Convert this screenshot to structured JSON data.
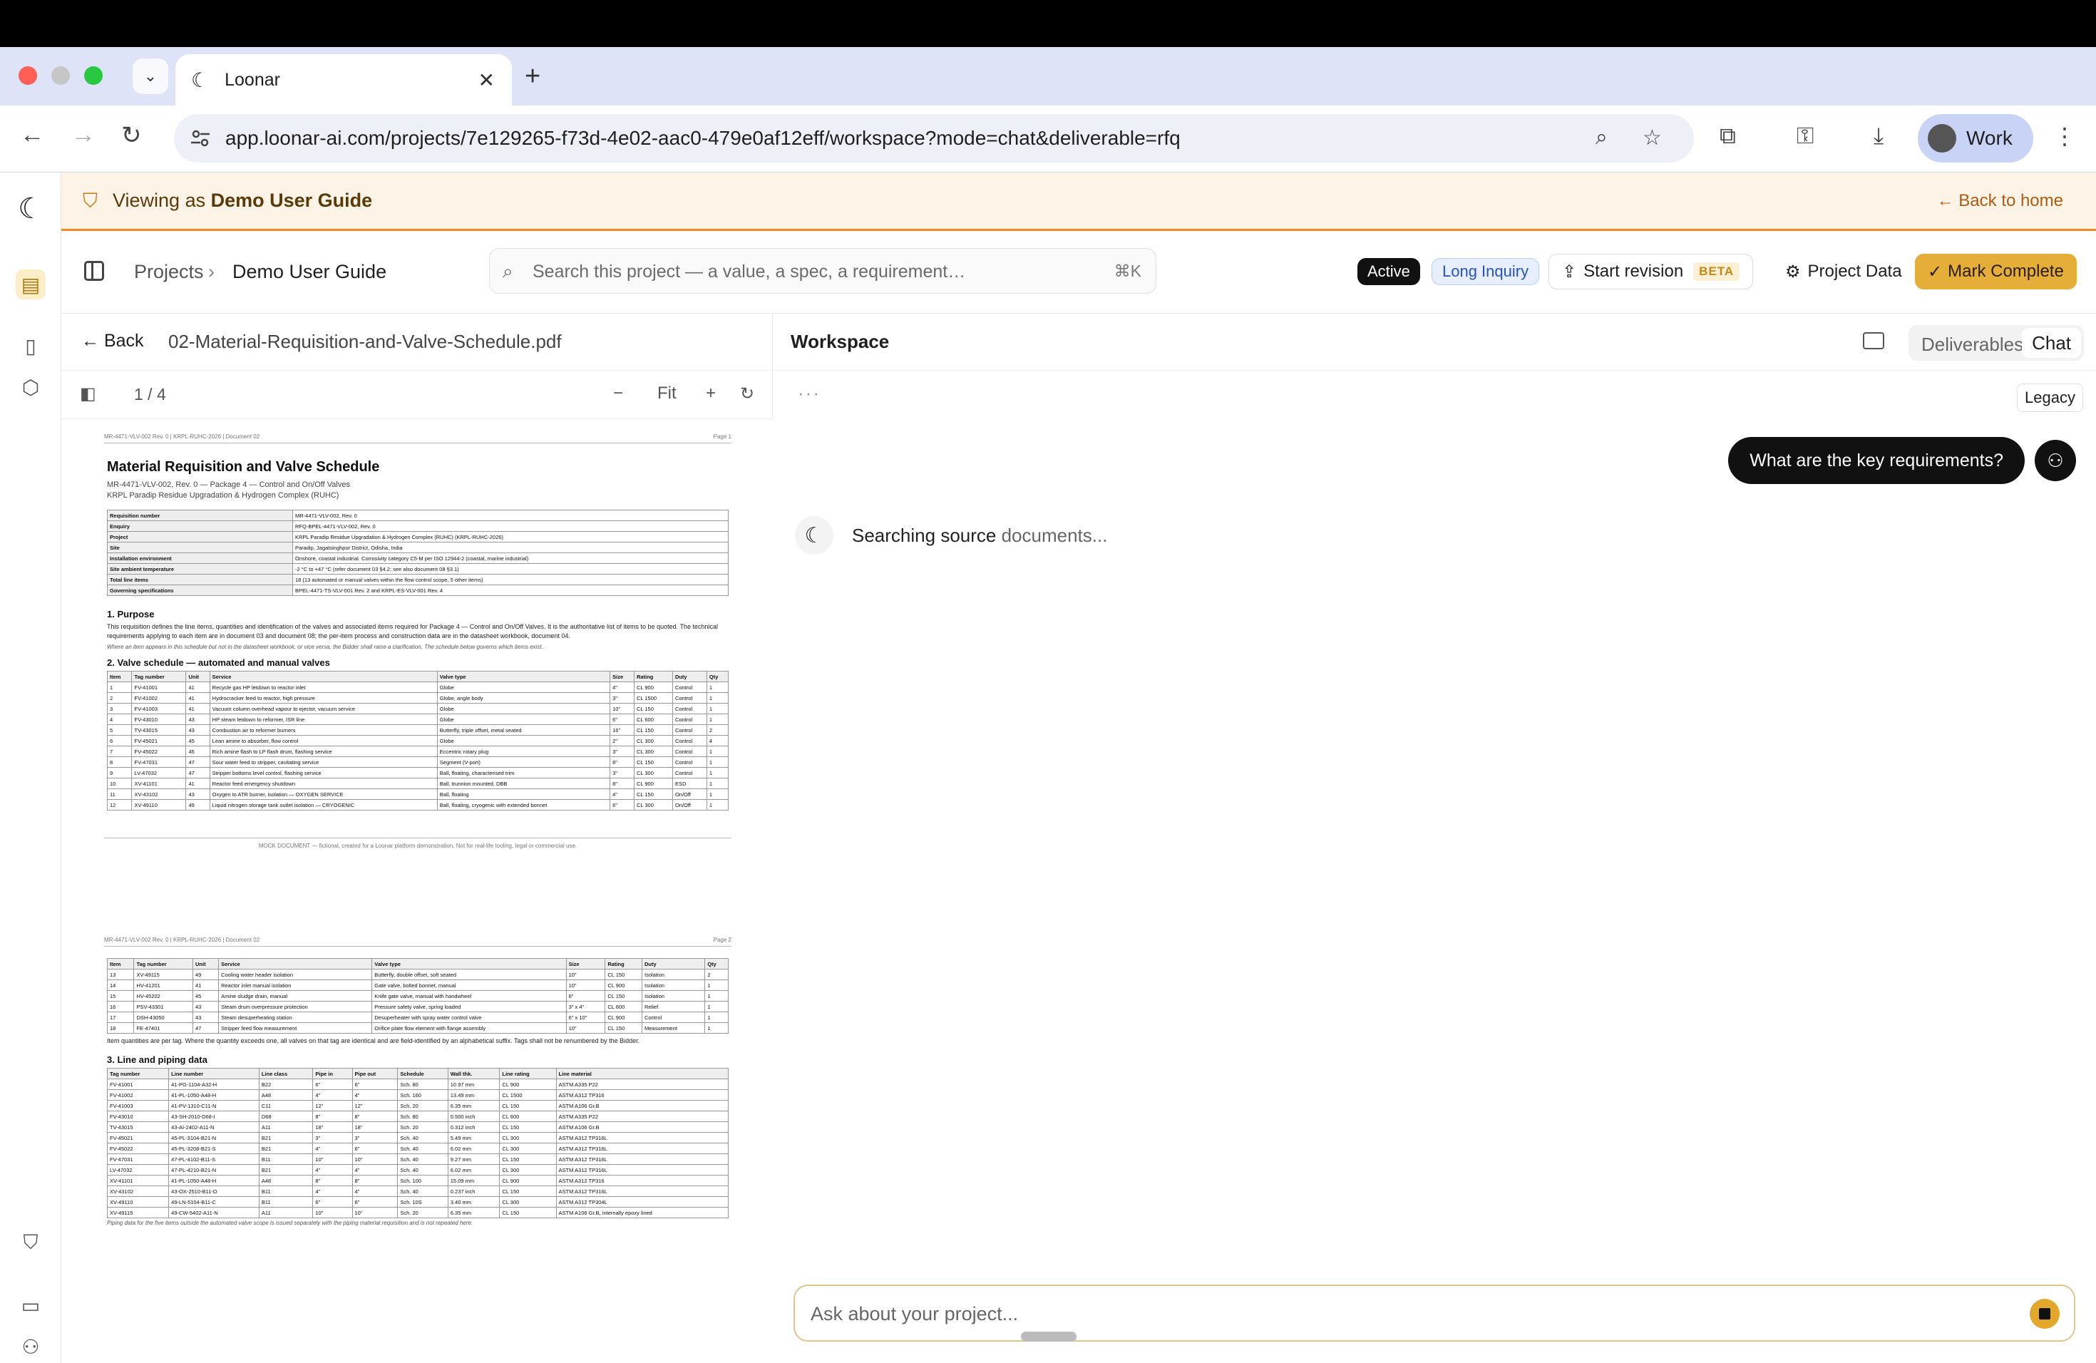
{
  "browser": {
    "tab_title": "Loonar",
    "url": "app.loonar-ai.com/projects/7e129265-f73d-4e02-aac0-479e0af12eff/workspace?mode=chat&deliverable=rfq",
    "profile_label": "Work"
  },
  "banner": {
    "prefix": "Viewing as",
    "user": "Demo User Guide",
    "back_label": "Back to home"
  },
  "header": {
    "crumb_root": "Projects",
    "crumb_current": "Demo User Guide",
    "search_placeholder": "Search this project — a value, a spec, a requirement…",
    "search_shortcut": "⌘K",
    "status_active": "Active",
    "status_inquiry": "Long Inquiry",
    "start_revision": "Start revision",
    "beta": "BETA",
    "project_data": "Project Data",
    "mark_complete": "Mark Complete"
  },
  "doc": {
    "back": "Back",
    "filename": "02-Material-Requisition-and-Valve-Schedule.pdf",
    "page_indicator": "1 / 4",
    "zoom_label": "Fit",
    "page1": {
      "hdr_left": "MR-4471-VLV-002 Rev. 0 | KRPL-RUHC-2026 | Document 02",
      "hdr_right": "Page 1",
      "title": "Material Requisition and Valve Schedule",
      "sub1": "MR-4471-VLV-002, Rev. 0 — Package 4 — Control and On/Off Valves",
      "sub2": "KRPL Paradip Residue Upgradation & Hydrogen Complex (RUHC)",
      "kv": [
        [
          "Requisition number",
          "MR-4471-VLV-002, Rev. 0"
        ],
        [
          "Enquiry",
          "RFQ-BPEL-4471-VLV-002, Rev. 0"
        ],
        [
          "Project",
          "KRPL Paradip Residue Upgradation & Hydrogen Complex (RUHC) (KRPL-RUHC-2026)"
        ],
        [
          "Site",
          "Paradip, Jagatsinghpur District, Odisha, India"
        ],
        [
          "Installation environment",
          "Onshore, coastal industrial. Corrosivity category C5-M per ISO 12944-2 (coastal, marine industrial)"
        ],
        [
          "Site ambient temperature",
          "-2 °C to +47 °C (refer document 03 §4.2; see also document 08 §3.1)"
        ],
        [
          "Total line items",
          "18 (13 automated or manual valves within the flow control scope, 5 other items)"
        ],
        [
          "Governing specifications",
          "BPEL-4471-TS-VLV-001 Rev. 2 and KRPL-ES-VLV-001 Rev. 4"
        ]
      ],
      "s1": "1. Purpose",
      "s1_text": "This requisition defines the line items, quantities and identification of the valves and associated items required for Package 4 — Control and On/Off Valves. It is the authoritative list of items to be quoted. The technical requirements applying to each item are in document 03 and document 08; the per-item process and construction data are in the datasheet workbook, document 04.",
      "s1_note": "Where an item appears in this schedule but not in the datasheet workbook, or vice versa, the Bidder shall raise a clarification. The schedule below governs which items exist.",
      "s2": "2. Valve schedule — automated and manual valves",
      "vs_headers": [
        "Item",
        "Tag number",
        "Unit",
        "Service",
        "Valve type",
        "Size",
        "Rating",
        "Duty",
        "Qty"
      ],
      "vs_rows": [
        [
          "1",
          "FV-41001",
          "41",
          "Recycle gas HP letdown to reactor inlet",
          "Globe",
          "4\"",
          "CL 900",
          "Control",
          "1"
        ],
        [
          "2",
          "FV-41002",
          "41",
          "Hydrocracker feed to reactor, high pressure",
          "Globe, angle body",
          "3\"",
          "CL 1500",
          "Control",
          "1"
        ],
        [
          "3",
          "FV-41003",
          "41",
          "Vacuum column overhead vapour to ejector, vacuum service",
          "Globe",
          "10\"",
          "CL 150",
          "Control",
          "1"
        ],
        [
          "4",
          "FV-43010",
          "43",
          "HP steam letdown to reformer, ISR line",
          "Globe",
          "6\"",
          "CL 600",
          "Control",
          "1"
        ],
        [
          "5",
          "TV-43015",
          "43",
          "Combustion air to reformer burners",
          "Butterfly, triple offset, metal seated",
          "16\"",
          "CL 150",
          "Control",
          "2"
        ],
        [
          "6",
          "FV-45021",
          "45",
          "Lean amine to absorber, flow control",
          "Globe",
          "2\"",
          "CL 300",
          "Control",
          "4"
        ],
        [
          "7",
          "FV-45022",
          "45",
          "Rich amine flash to LP flash drum, flashing service",
          "Eccentric rotary plug",
          "3\"",
          "CL 300",
          "Control",
          "1"
        ],
        [
          "8",
          "FV-47031",
          "47",
          "Sour water feed to stripper, cavitating service",
          "Segment (V-port)",
          "8\"",
          "CL 150",
          "Control",
          "1"
        ],
        [
          "9",
          "LV-47032",
          "47",
          "Stripper bottoms level control, flashing service",
          "Ball, floating, characterised trim",
          "3\"",
          "CL 300",
          "Control",
          "1"
        ],
        [
          "10",
          "XV-41101",
          "41",
          "Reactor feed emergency shutdown",
          "Ball, trunnion mounted, DBB",
          "8\"",
          "CL 900",
          "ESD",
          "1"
        ],
        [
          "11",
          "XV-43102",
          "43",
          "Oxygen to ATR burner, isolation — OXYGEN SERVICE",
          "Ball, floating",
          "4\"",
          "CL 150",
          "On/Off",
          "1"
        ],
        [
          "12",
          "XV-49110",
          "49",
          "Liquid nitrogen storage tank outlet isolation — CRYOGENIC",
          "Ball, floating, cryogenic with extended bonnet",
          "6\"",
          "CL 300",
          "On/Off",
          "1"
        ]
      ],
      "footer": "MOCK DOCUMENT — fictional, created for a Loonar platform demonstration. Not for real-life tooling, legal or commercial use."
    },
    "page2": {
      "hdr_left": "MR-4471-VLV-002 Rev. 0 | KRPL-RUHC-2026 | Document 02",
      "hdr_right": "Page 2",
      "vs_rows": [
        [
          "13",
          "XV-49115",
          "49",
          "Cooling water header isolation",
          "Butterfly, double offset, soft seated",
          "10\"",
          "CL 150",
          "Isolation",
          "2"
        ],
        [
          "14",
          "HV-41201",
          "41",
          "Reactor inlet manual isolation",
          "Gate valve, bolted bonnet, manual",
          "10\"",
          "CL 900",
          "Isolation",
          "1"
        ],
        [
          "15",
          "HV-45202",
          "45",
          "Amine sludge drain, manual",
          "Knife gate valve, manual with handwheel",
          "6\"",
          "CL 150",
          "Isolation",
          "1"
        ],
        [
          "16",
          "PSV-43301",
          "43",
          "Steam drum overpressure protection",
          "Pressure safety valve, spring loaded",
          "3\" x 4\"",
          "CL 600",
          "Relief",
          "1"
        ],
        [
          "17",
          "DSH-43050",
          "43",
          "Steam desuperheating station",
          "Desuperheater with spray water control valve",
          "6\" x 10\"",
          "CL 900",
          "Control",
          "1"
        ],
        [
          "18",
          "FE-47401",
          "47",
          "Stripper feed flow measurement",
          "Orifice plate flow element with flange assembly",
          "10\"",
          "CL 150",
          "Measurement",
          "1"
        ]
      ],
      "qty_note": "Item quantities are per tag. Where the quantity exceeds one, all valves on that tag are identical and are field-identified by an alphabetical suffix. Tags shall not be renumbered by the Bidder.",
      "s3": "3. Line and piping data",
      "lp_headers": [
        "Tag number",
        "Line number",
        "Line class",
        "Pipe in",
        "Pipe out",
        "Schedule",
        "Wall thk.",
        "Line rating",
        "Line material"
      ],
      "lp_rows": [
        [
          "FV-41001",
          "41-PG-1104-A32-H",
          "B22",
          "6\"",
          "6\"",
          "Sch. 80",
          "10.97 mm",
          "CL 900",
          "ASTM A335 P22"
        ],
        [
          "FV-41002",
          "41-PL-1050-A48-H",
          "A48",
          "4\"",
          "4\"",
          "Sch. 160",
          "13.49 mm",
          "CL 1500",
          "ASTM A312 TP316"
        ],
        [
          "FV-41003",
          "41-PV-1310-C11-N",
          "C11",
          "12\"",
          "12\"",
          "Sch. 20",
          "6.35 mm",
          "CL 150",
          "ASTM A106 Gr.B"
        ],
        [
          "FV-43010",
          "43-SH-2010-D68-I",
          "D68",
          "8\"",
          "8\"",
          "Sch. 80",
          "0.500 inch",
          "CL 600",
          "ASTM A335 P22"
        ],
        [
          "TV-43015",
          "43-AI-2402-A11-N",
          "A11",
          "18\"",
          "18\"",
          "Sch. 20",
          "0.312 inch",
          "CL 150",
          "ASTM A106 Gr.B"
        ],
        [
          "FV-45021",
          "45-PL-3104-B21-N",
          "B21",
          "3\"",
          "3\"",
          "Sch. 40",
          "5.49 mm",
          "CL 300",
          "ASTM A312 TP316L"
        ],
        [
          "FV-45022",
          "45-PL-3208-B21-S",
          "B21",
          "4\"",
          "6\"",
          "Sch. 40",
          "6.02 mm",
          "CL 300",
          "ASTM A312 TP316L"
        ],
        [
          "FV-47031",
          "47-PL-4102-B11-S",
          "B11",
          "10\"",
          "10\"",
          "Sch. 40",
          "9.27 mm",
          "CL 150",
          "ASTM A312 TP316L"
        ],
        [
          "LV-47032",
          "47-PL-4210-B21-N",
          "B21",
          "4\"",
          "4\"",
          "Sch. 40",
          "6.02 mm",
          "CL 300",
          "ASTM A312 TP316L"
        ],
        [
          "XV-41101",
          "41-PL-1050-A48-H",
          "A48",
          "8\"",
          "8\"",
          "Sch. 100",
          "15.09 mm",
          "CL 900",
          "ASTM A312 TP316"
        ],
        [
          "XV-43102",
          "43-OX-2510-B11-O",
          "B11",
          "4\"",
          "4\"",
          "Sch. 40",
          "0.237 inch",
          "CL 150",
          "ASTM A312 TP316L"
        ],
        [
          "XV-49110",
          "49-LN-5104-B11-C",
          "B11",
          "6\"",
          "6\"",
          "Sch. 10S",
          "3.40 mm",
          "CL 300",
          "ASTM A312 TP304L"
        ],
        [
          "XV-49115",
          "49-CW-5402-A11-N",
          "A11",
          "10\"",
          "10\"",
          "Sch. 20",
          "6.35 mm",
          "CL 150",
          "ASTM A106 Gr.B, internally epoxy lined"
        ]
      ],
      "lp_note": "Piping data for the five items outside the automated valve scope is issued separately with the piping material requisition and is not repeated here."
    }
  },
  "workspace": {
    "title": "Workspace",
    "tab_deliverables": "Deliverables",
    "tab_chat": "Chat",
    "legacy": "Legacy",
    "user_message": "What are the key requirements?",
    "status_a": "Searching",
    "status_b": "source",
    "status_c": "documents...",
    "composer_placeholder": "Ask about your project..."
  }
}
